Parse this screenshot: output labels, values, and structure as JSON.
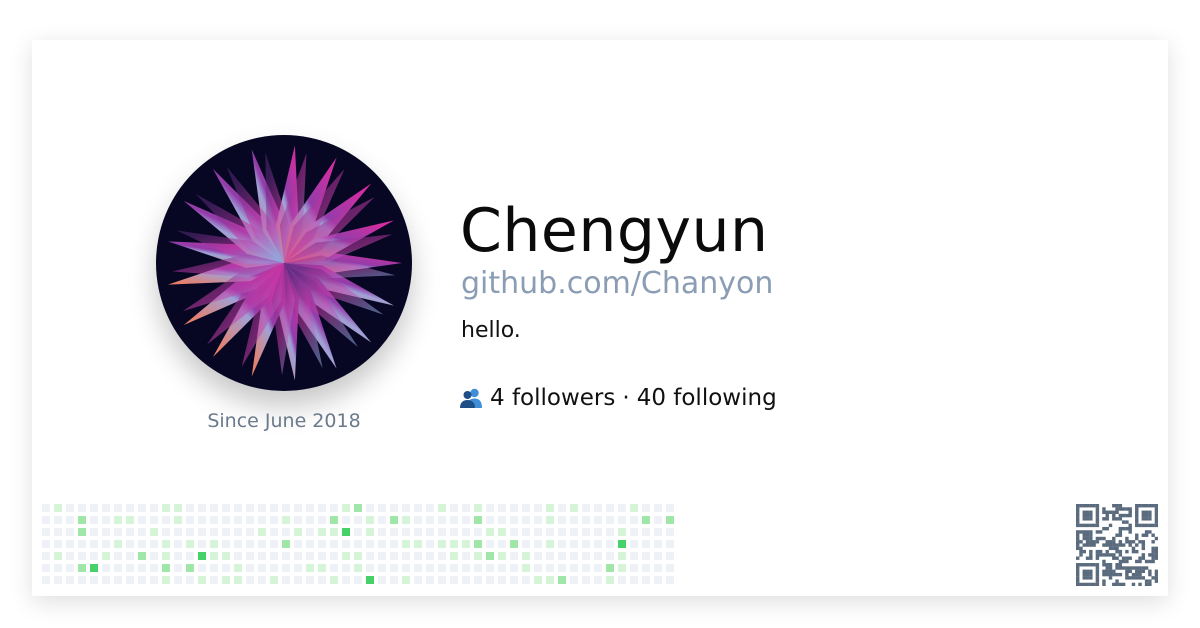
{
  "profile": {
    "display_name": "Chengyun",
    "handle_url": "github.com/Chanyon",
    "bio": "hello.",
    "since": "Since June 2018",
    "followers": "4 followers",
    "separator": "·",
    "following": "40 following"
  },
  "icons": {
    "people": "people-icon",
    "avatar": "starburst-avatar",
    "qr": "qr-code"
  },
  "colors": {
    "name": "#0b0b0b",
    "handle": "#8a9db4",
    "since": "#6a7a8c",
    "contrib_empty": "#eef1f6",
    "contrib_lvl1": "#d6f5d8",
    "contrib_lvl2": "#9fe6a8",
    "contrib_lvl3": "#46d169",
    "qr": "#5b6b7e"
  },
  "contributions": {
    "weeks": 53,
    "days": 7,
    "levels_legend": [
      0,
      1,
      2,
      3
    ]
  }
}
